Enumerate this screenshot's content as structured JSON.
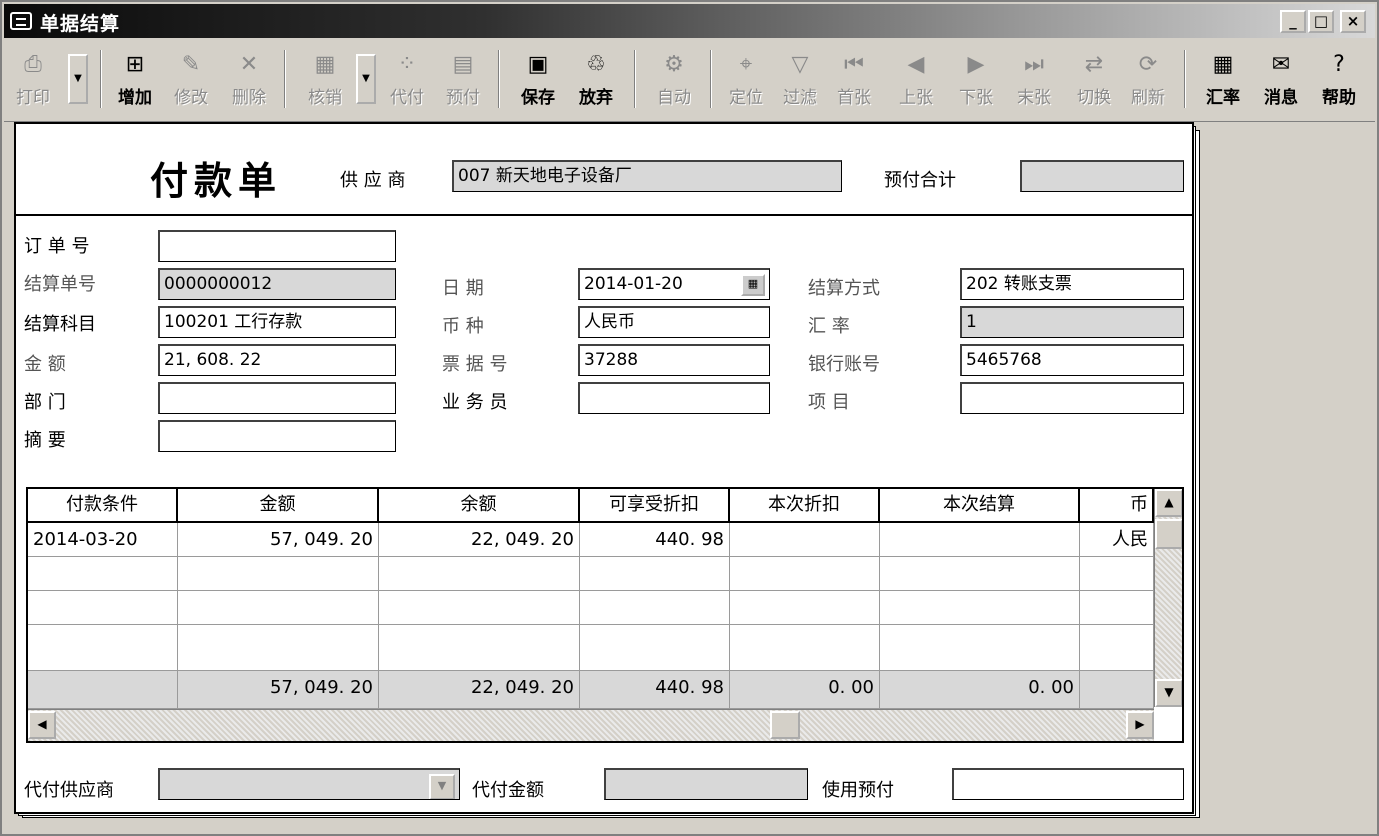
{
  "window": {
    "title": "单据结算",
    "minimize": "_",
    "maximize": "□",
    "close": "×"
  },
  "toolbar": {
    "buttons": [
      {
        "label": "打印",
        "icon": "⎙"
      },
      {
        "label": "增加",
        "icon": "⊞"
      },
      {
        "label": "修改",
        "icon": "✎"
      },
      {
        "label": "删除",
        "icon": "✕"
      },
      {
        "label": "核销",
        "icon": "▦"
      },
      {
        "label": "代付",
        "icon": "⁘"
      },
      {
        "label": "预付",
        "icon": "▤"
      },
      {
        "label": "保存",
        "icon": "▣"
      },
      {
        "label": "放弃",
        "icon": "♲"
      },
      {
        "label": "自动",
        "icon": "⚙"
      },
      {
        "label": "定位",
        "icon": "⌖"
      },
      {
        "label": "过滤",
        "icon": "▽"
      },
      {
        "label": "首张",
        "icon": "⏮"
      },
      {
        "label": "上张",
        "icon": "◀"
      },
      {
        "label": "下张",
        "icon": "▶"
      },
      {
        "label": "末张",
        "icon": "⏭"
      },
      {
        "label": "切换",
        "icon": "⇄"
      },
      {
        "label": "刷新",
        "icon": "⟳"
      },
      {
        "label": "汇率",
        "icon": "▦"
      },
      {
        "label": "消息",
        "icon": "✉"
      },
      {
        "label": "帮助",
        "icon": "?"
      }
    ],
    "dropdown_arrow": "▼"
  },
  "header": {
    "form_title": "付款单",
    "supplier_label": "供 应 商",
    "supplier_value": "007   新天地电子设备厂",
    "prepay_total_label": "预付合计",
    "prepay_total_value": ""
  },
  "form": {
    "order_no_label": "订 单 号",
    "order_no_value": "",
    "settle_no_label": "结算单号",
    "settle_no_value": "0000000012",
    "date_label": "日    期",
    "date_value": "2014-01-20",
    "settle_method_label": "结算方式",
    "settle_method_value": "202   转账支票",
    "settle_account_label": "结算科目",
    "settle_account_value": "100201   工行存款",
    "currency_label": "币    种",
    "currency_value": "人民币",
    "rate_label": "汇    率",
    "rate_value": "1",
    "amount_label": "金    额",
    "amount_value": "21, 608. 22",
    "bill_no_label": "票 据 号",
    "bill_no_value": "37288",
    "bank_account_label": "银行账号",
    "bank_account_value": "5465768",
    "dept_label": "部    门",
    "dept_value": "",
    "salesman_label": "业 务 员",
    "salesman_value": "",
    "project_label": "项    目",
    "project_value": "",
    "summary_label": "摘    要",
    "summary_value": ""
  },
  "grid": {
    "columns": [
      "付款条件",
      "金额",
      "余额",
      "可享受折扣",
      "本次折扣",
      "本次结算",
      "币"
    ],
    "rows": [
      [
        "2014-03-20",
        "57, 049. 20",
        "22, 049. 20",
        "440. 98",
        "",
        "",
        "人民"
      ],
      [
        "",
        "",
        "",
        "",
        "",
        "",
        ""
      ],
      [
        "",
        "",
        "",
        "",
        "",
        "",
        ""
      ],
      [
        "",
        "",
        "",
        "",
        "",
        "",
        ""
      ]
    ],
    "total": [
      "",
      "57, 049. 20",
      "22, 049. 20",
      "440. 98",
      "0. 00",
      "0. 00",
      ""
    ]
  },
  "footer": {
    "proxy_supplier_label": "代付供应商",
    "proxy_supplier_value": "",
    "proxy_amount_label": "代付金额",
    "proxy_amount_value": "",
    "use_prepay_label": "使用预付",
    "use_prepay_value": ""
  }
}
